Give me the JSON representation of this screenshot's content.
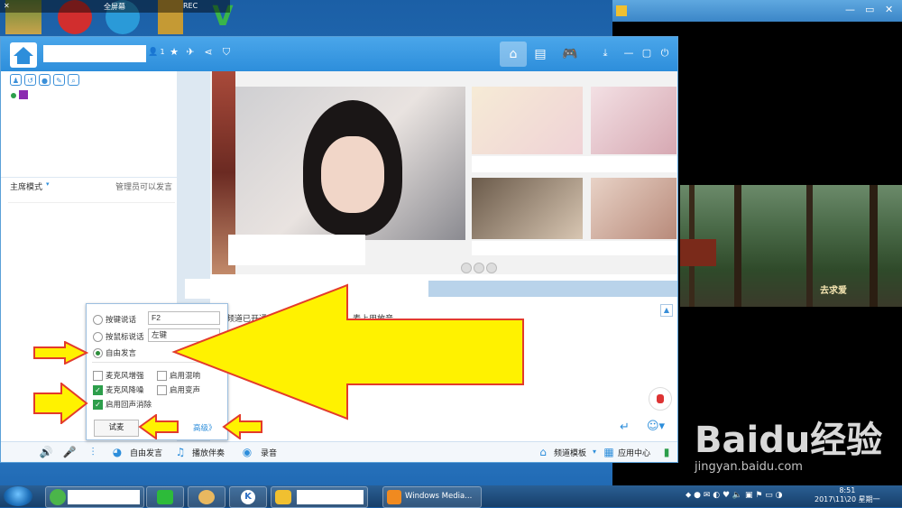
{
  "recorder_bar": {
    "fullscreen_label": "全屏幕",
    "rec_label": "REC"
  },
  "window": {
    "user_count": "1",
    "left_panel": {
      "mode_label": "主席模式",
      "admin_note": "管理员可以发言"
    },
    "chat": {
      "notice_1": "频道已开通",
      "notice_2": "麦上用放音"
    },
    "popup": {
      "ptt_key_label": "按键说话",
      "ptt_key_value": "F2",
      "mouse_key_label": "按鼠标说话",
      "mouse_key_value": "左键",
      "free_speech_label": "自由发言",
      "mic_boost_label": "麦克风增强",
      "reverb_label": "启用混响",
      "noise_reduction_label": "麦克风降噪",
      "voice_change_label": "启用变声",
      "echo_cancel_label": "启用回声消除",
      "try_button": "试麦",
      "advanced_link": "高级》"
    },
    "bottombar": {
      "free_speech": "自由发言",
      "accompaniment": "播放伴奏",
      "record": "录音",
      "channel_template": "频道模板",
      "app_center": "应用中心"
    }
  },
  "video_window": {
    "overlay_text": "去求爱"
  },
  "taskbar": {
    "media_player": "Windows Media...",
    "time": "8:51",
    "date": "2017\\11\\20 星期一"
  },
  "watermark": {
    "main": "Baidu经验",
    "sub": "jingyan.baidu.com"
  },
  "colors": {
    "titlebar": "#2d8edb",
    "arrow_fill": "#fff200",
    "arrow_stroke": "#e33b2b",
    "checked": "#2d9e4b"
  }
}
